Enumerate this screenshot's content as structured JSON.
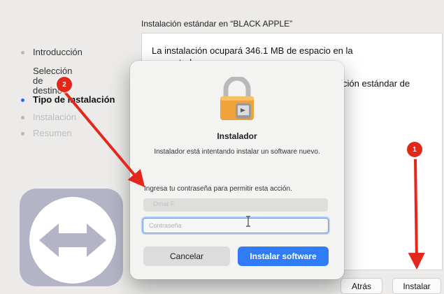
{
  "content": {
    "title": "Instalación estándar en “BLACK APPLE”",
    "line1": "La instalación ocupará 346.1 MB de espacio en la",
    "line2": "computadora",
    "line3": "ción estándar de"
  },
  "sidebar": {
    "steps": [
      {
        "label": "Introducción",
        "state": "done"
      },
      {
        "label": "Selección\nde destino",
        "state": "done"
      },
      {
        "label": "Tipo de instalación",
        "state": "current"
      },
      {
        "label": "Instalación",
        "state": "future"
      },
      {
        "label": "Resumen",
        "state": "future"
      }
    ]
  },
  "app_icon": "teamviewer-arrows-icon",
  "bottom_buttons": {
    "back_label": "Atrás",
    "install_label": "Instalar"
  },
  "dialog": {
    "icon": "lock-icon",
    "title": "Instalador",
    "message": "Instalador está intentando instalar un software nuevo.",
    "prompt": "Ingresa tu contraseña para permitir esta acción.",
    "username_value": "Omar F",
    "password_placeholder": "Contraseña",
    "cancel_label": "Cancelar",
    "install_software_label": "Instalar software"
  },
  "annotations": {
    "badge_1": "1",
    "badge_2": "2",
    "marker_color": "#e3281b"
  },
  "colors": {
    "accent": "#2f7cf6",
    "current_step_dot": "#1f6ff2",
    "lock_body": "#f0a23a"
  }
}
